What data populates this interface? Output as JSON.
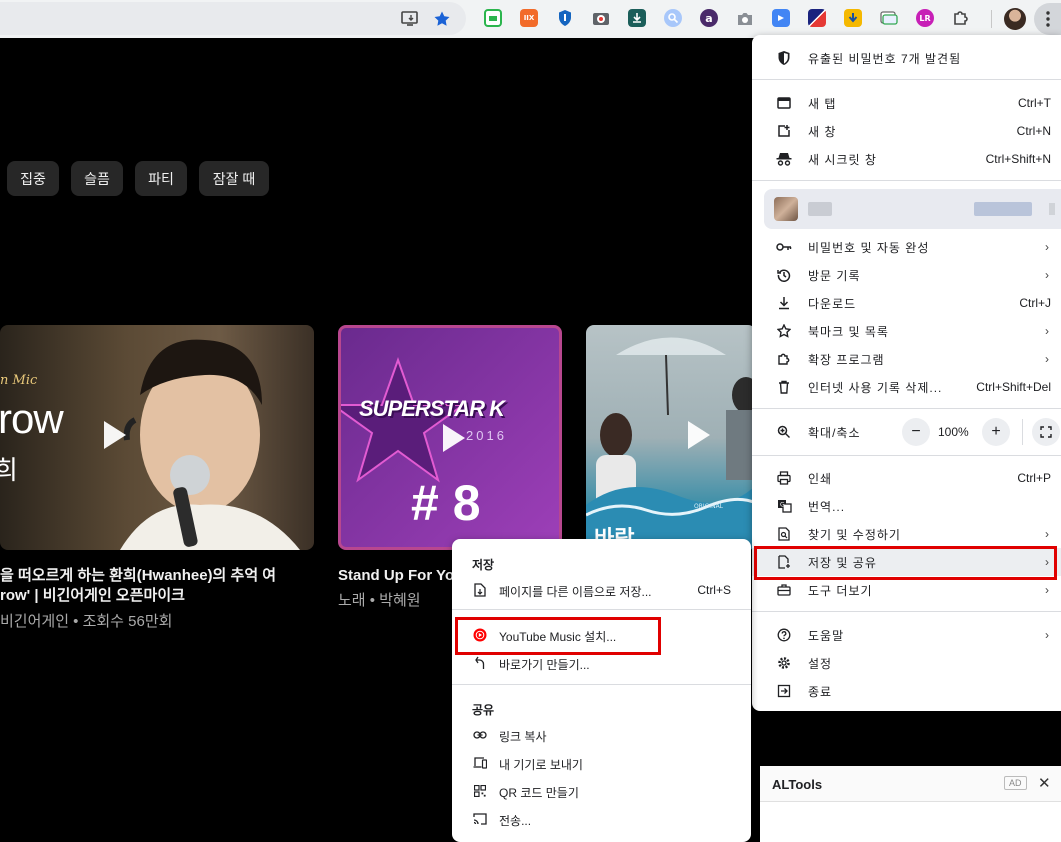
{
  "chips": [
    "집중",
    "슬픔",
    "파티",
    "잠잘 때"
  ],
  "videos": [
    {
      "title_line1": "을 떠오르게 하는 환희(Hwanhee)의 추억 여",
      "title_line2": "row' | 비긴어게인 오픈마이크",
      "meta": "비긴어게인 • 조회수 56만회",
      "thumb_text_big": "row",
      "thumb_text_small": "희",
      "thumb_script": "n Mic"
    },
    {
      "title_line1": "Stand Up For Yo",
      "meta": "노래 • 박혜원",
      "thumb_logo": "SUPERSTAR K",
      "thumb_year": "2016",
      "thumb_ep": "# 8"
    },
    {
      "thumb_text": "바람",
      "thumb_small": "ORIGINAL"
    }
  ],
  "menu": {
    "password_warning": "유출된 비밀번호 7개 발견됨",
    "new_tab": "새 탭",
    "new_tab_sc": "Ctrl+T",
    "new_window": "새 창",
    "new_window_sc": "Ctrl+N",
    "incognito": "새 시크릿 창",
    "incognito_sc": "Ctrl+Shift+N",
    "passwords": "비밀번호 및 자동 완성",
    "history": "방문 기록",
    "downloads": "다운로드",
    "downloads_sc": "Ctrl+J",
    "bookmarks": "북마크 및 목록",
    "extensions": "확장 프로그램",
    "clear_data": "인터넷 사용 기록 삭제...",
    "clear_data_sc": "Ctrl+Shift+Del",
    "zoom_label": "확대/축소",
    "zoom_minus": "−",
    "zoom_value": "100%",
    "zoom_plus": "+",
    "print": "인쇄",
    "print_sc": "Ctrl+P",
    "translate": "번역...",
    "find_edit": "찾기 및 수정하기",
    "save_share": "저장 및 공유",
    "more_tools": "도구 더보기",
    "help": "도움말",
    "settings": "설정",
    "exit": "종료"
  },
  "submenu": {
    "save_header": "저장",
    "save_as": "페이지를 다른 이름으로 저장...",
    "save_as_sc": "Ctrl+S",
    "install_app": "YouTube Music 설치...",
    "shortcut": "바로가기 만들기...",
    "share_header": "공유",
    "copy_link": "링크 복사",
    "send_devices": "내 기기로 보내기",
    "qr_code": "QR 코드 만들기",
    "cast": "전송..."
  },
  "altools": {
    "title": "ALTools",
    "ad_badge": "AD",
    "close": "✕"
  },
  "colors": {
    "highlight": "#e00000",
    "youtube_red": "#ff0000",
    "chip_bg": "#272727"
  }
}
